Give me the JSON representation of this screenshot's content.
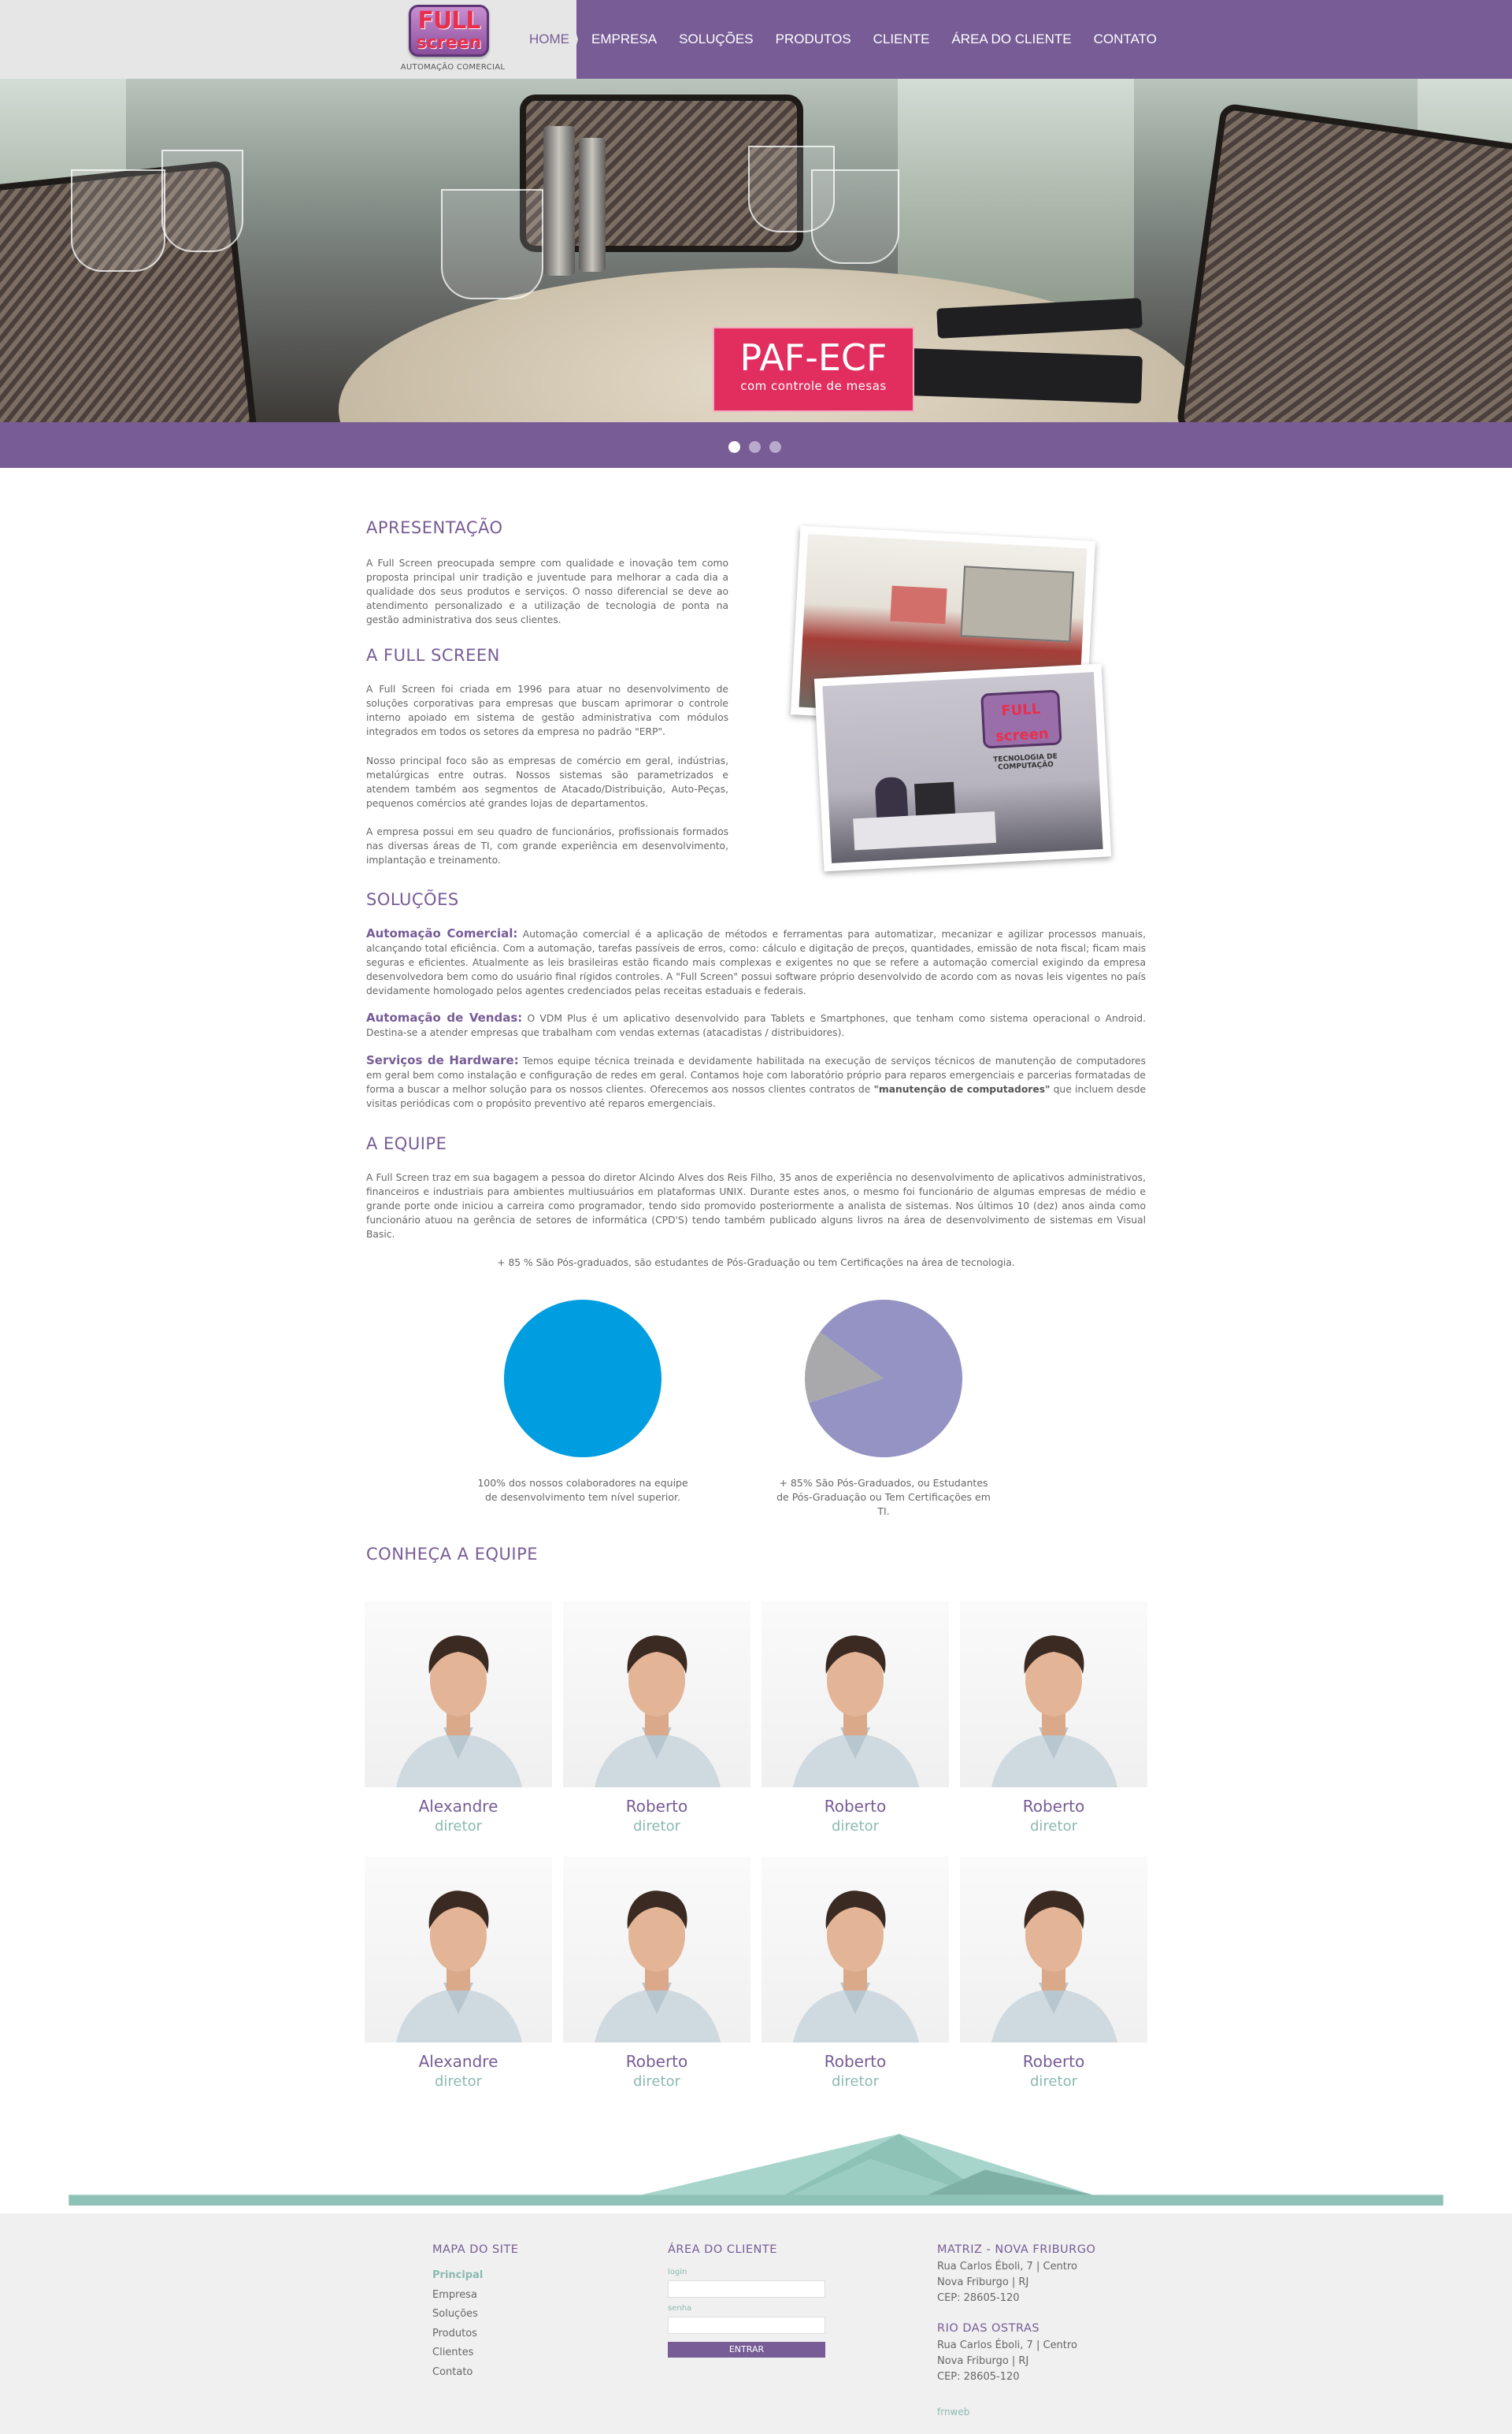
{
  "brand": {
    "logo_line1": "FULL",
    "logo_line2": "screen",
    "tagline": "AUTOMAÇÃO COMERCIAL",
    "accent": "#775c96",
    "teal": "#8bbab0"
  },
  "nav": {
    "items": [
      "HOME",
      "EMPRESA",
      "SOLUÇÕES",
      "PRODUTOS",
      "CLIENTE",
      "ÁREA DO CLIENTE",
      "CONTATO"
    ]
  },
  "hero": {
    "badge_title": "PAF-ECF",
    "badge_subtitle": "com controle de mesas",
    "slides": 3,
    "active_slide": 1
  },
  "apresentacao": {
    "title": "APRESENTAÇÃO",
    "text": "A Full Screen preocupada sempre com qualidade e inovação tem como proposta principal unir tradição e juventude para melhorar a cada dia a qualidade dos seus produtos e serviços. O nosso diferencial se deve ao atendimento personalizado e a utilização de tecnologia de ponta na gestão administrativa dos seus clientes."
  },
  "full_screen": {
    "title": "A FULL SCREEN",
    "p1": "A Full Screen foi criada em 1996 para atuar no desenvolvimento de soluções corporativas para empresas que buscam aprimorar o controle interno apoiado em sistema de gestão administrativa com módulos integrados em todos os setores da empresa no padrão \"ERP\".",
    "p2": "Nosso principal foco são as empresas de comércio em geral, indústrias, metalúrgicas entre outras. Nossos sistemas são parametrizados e atendem também aos segmentos de Atacado/Distribuição, Auto-Peças, pequenos comércios até grandes lojas de departamentos.",
    "p3": "A empresa possui em seu quadro de funcionários, profissionais formados nas diversas áreas de TI, com grande experiência em desenvolvimento, implantação e treinamento.",
    "photo_sign_line1": "FULL",
    "photo_sign_line2": "screen",
    "photo_sign_caption": "TECNOLOGIA DE COMPUTAÇÃO"
  },
  "solucoes": {
    "title": "SOLUÇÕES",
    "items": [
      {
        "label": "Automação Comercial:",
        "text": " Automação comercial é a aplicação de métodos e ferramentas para automatizar, mecanizar e agilizar processos manuais, alcançando total eficiência. Com a automação, tarefas passíveis de erros, como: cálculo e digitação de preços, quantidades, emissão de nota fiscal; ficam mais seguras e eficientes. Atualmente as leis brasileiras estão ficando mais complexas e exigentes no que se refere a automação comercial exigindo da empresa desenvolvedora bem como do usuário final rígidos controles. A \"Full Screen\" possui software próprio desenvolvido de acordo com as novas leis vigentes no país devidamente homologado pelos agentes credenciados pelas receitas estaduais e federais."
      },
      {
        "label": "Automação de Vendas:",
        "text": " O VDM Plus é um aplicativo desenvolvido para Tablets e Smartphones, que tenham como sistema operacional o Android. Destina-se a atender empresas que trabalham com vendas externas (atacadistas / distribuidores)."
      },
      {
        "label": "Serviços de Hardware:",
        "text": " Temos equipe técnica treinada e devidamente habilitada na execução de serviços técnicos de manutenção de computadores em geral bem como instalação e configuração de redes em geral. Contamos hoje com laboratório próprio para reparos emergenciais e parcerias formatadas de forma a buscar a melhor solução para os nossos clientes. Oferecemos aos nossos clientes contratos de ",
        "strong": "\"manutenção de computadores\"",
        "tail": " que incluem desde visitas periódicas com o propósito preventivo até reparos emergenciais."
      }
    ]
  },
  "equipe": {
    "title": "A EQUIPE",
    "text": "A Full Screen traz em sua bagagem a pessoa do diretor Alcindo Alves dos Reis Filho, 35 anos de experiência no desenvolvimento de aplicativos administrativos, financeiros e industriais para ambientes multiusuários em plataformas UNIX. Durante estes anos, o mesmo foi funcionário de algumas empresas de médio e grande porte onde iniciou a carreira como programador, tendo sido promovido posteriormente a analista de sistemas. Nos últimos 10 (dez) anos ainda como funcionário atuou na gerência de setores de informática (CPD'S) tendo também publicado alguns livros na área de desenvolvimento de sistemas em Visual Basic.",
    "stat_line": "+ 85 % São Pós-graduados, são estudantes de Pós-Graduação ou tem Certificações na área de tecnologia."
  },
  "chart_data": [
    {
      "type": "pie",
      "values": [
        100
      ],
      "colors": [
        "#009de0"
      ],
      "caption": "100% dos nossos colaboradores na equipe de desenvolvimento tem nível superior."
    },
    {
      "type": "pie",
      "values": [
        85,
        15
      ],
      "colors": [
        "#9593c4",
        "#a9a9ab"
      ],
      "caption": "+ 85% São Pós-Graduados, ou Estudantes de Pós-Graduação ou Tem Certificações em TI."
    }
  ],
  "team": {
    "title": "CONHEÇA A EQUIPE",
    "members": [
      {
        "name": "Alexandre",
        "role": "diretor"
      },
      {
        "name": "Roberto",
        "role": "diretor"
      },
      {
        "name": "Roberto",
        "role": "diretor"
      },
      {
        "name": "Roberto",
        "role": "diretor"
      },
      {
        "name": "Alexandre",
        "role": "diretor"
      },
      {
        "name": "Roberto",
        "role": "diretor"
      },
      {
        "name": "Roberto",
        "role": "diretor"
      },
      {
        "name": "Roberto",
        "role": "diretor"
      }
    ]
  },
  "footer": {
    "sitemap_title": "MAPA DO SITE",
    "sitemap": [
      "Principal",
      "Empresa",
      "Soluções",
      "Produtos",
      "Clientes",
      "Contato"
    ],
    "client_title": "ÁREA DO CLIENTE",
    "login_label": "login",
    "senha_label": "senha",
    "enter_button": "ENTRAR",
    "office1_title": "MATRIZ - NOVA FRIBURGO",
    "office1_lines": [
      "Rua Carlos Éboli, 7 | Centro",
      "Nova Friburgo | RJ",
      "CEP: 28605-120"
    ],
    "office2_title": "RIO DAS OSTRAS",
    "office2_lines": [
      "Rua Carlos Éboli, 7 | Centro",
      "Nova Friburgo | RJ",
      "CEP: 28605-120"
    ],
    "credit": "frnweb"
  }
}
